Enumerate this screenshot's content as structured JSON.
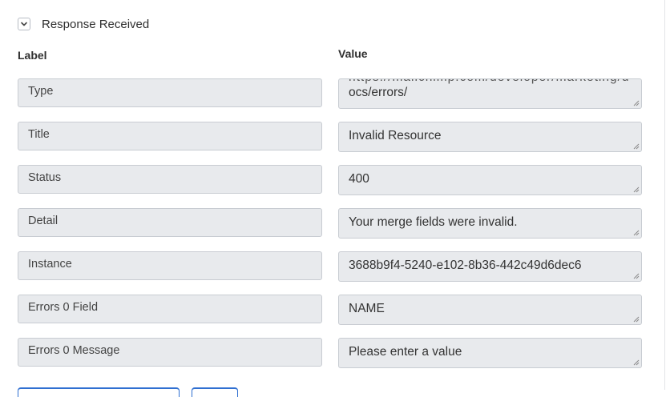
{
  "section": {
    "title": "Response Received",
    "toggle_icon": "chevron-down-icon"
  },
  "columns": {
    "label": "Label",
    "value": "Value"
  },
  "rows": [
    {
      "label": "Type",
      "value_line1": "https://mailchimp.com/developer/marketing/d",
      "value": "ocs/errors/"
    },
    {
      "label": "Title",
      "value": "Invalid Resource"
    },
    {
      "label": "Status",
      "value": "400"
    },
    {
      "label": "Detail",
      "value": "Your merge fields were invalid."
    },
    {
      "label": "Instance",
      "value": "3688b9f4-5240-e102-8b36-442c49d6dec6"
    },
    {
      "label": "Errors 0 Field",
      "value": "NAME"
    },
    {
      "label": "Errors 0 Message",
      "value": "Please enter a value"
    }
  ],
  "colors": {
    "field_bg": "#e8eaed",
    "field_border": "#c8ccd2",
    "accent": "#2f6fd1"
  }
}
